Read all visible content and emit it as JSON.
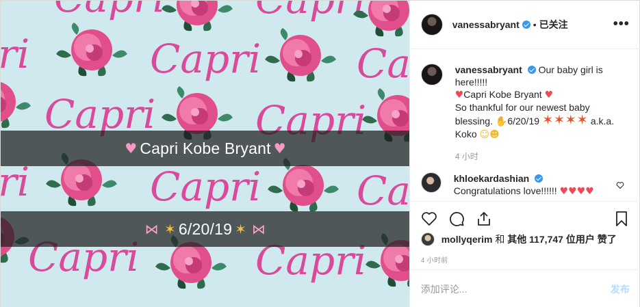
{
  "photo": {
    "pattern_word": "Capri",
    "caption_name": "Capri Kobe Bryant",
    "caption_date": "6/20/19",
    "colors": {
      "background": "#cfe9ee",
      "word": "#d94b9a",
      "rose": "#e04f8c",
      "leaf": "#2f6b4c"
    }
  },
  "header": {
    "username": "vanessabryant",
    "separator": "•",
    "follow_state": "已关注",
    "more_label": "•••"
  },
  "caption": {
    "username": "vanessabryant",
    "line1": "Our baby girl is here!!!!!",
    "line2": "Capri Kobe Bryant",
    "line3": "So thankful for our newest baby blessing.",
    "line3_date": "6/20/19",
    "line4_aka": "a.k.a.",
    "line4_name": "Koko",
    "time": "4 小时"
  },
  "comment": {
    "username": "khloekardashian",
    "text": "Congratulations love!!!!!!"
  },
  "likes": {
    "liker": "mollyqerim",
    "connector": "和",
    "others_label": "其他",
    "count": "117,747",
    "suffix": "位用户 赞了"
  },
  "post_time": "4 小时前",
  "composer": {
    "placeholder": "添加评论...",
    "post_label": "发布"
  },
  "icons": [
    "heart-icon",
    "comment-icon",
    "share-icon",
    "bookmark-icon",
    "verified-icon",
    "more-icon"
  ]
}
